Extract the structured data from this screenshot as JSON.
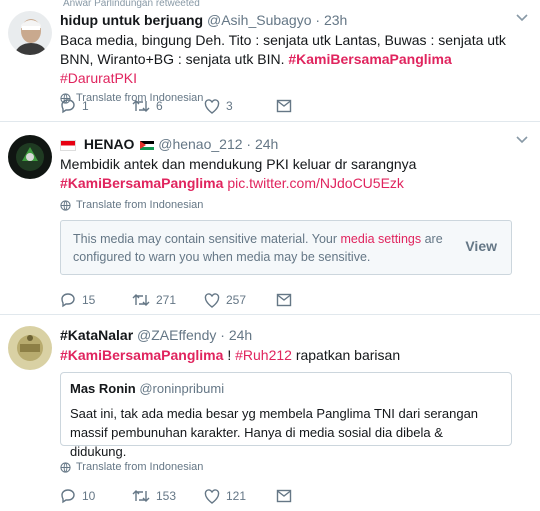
{
  "tweet1": {
    "top_context": "Anwar Parlindungan retweeted",
    "display_name": "hidup untuk berjuang",
    "handle": "@Asih_Subagyo",
    "time": "· 23h",
    "text": "Baca media, bingung Deh. Tito : senjata utk Lantas, Buwas : senjata utk BNN, Wiranto+BG : senjata utk BIN.",
    "hashtag1": "#KamiBersamaPanglima",
    "hashtag2": "#DaruratPKI",
    "translate": "Translate from Indonesian",
    "replies": "1",
    "retweets": "6",
    "likes": "3",
    "icons": [
      "reply-icon",
      "retweet-icon",
      "like-icon",
      "dm-icon",
      "globe-icon",
      "chevron-down-icon"
    ]
  },
  "tweet2": {
    "display_name": "HENAO",
    "handle": "@henao_212",
    "time": "· 24h",
    "text": "Membidik antek dan mendukung PKI keluar dr sarangnya",
    "hashtag": "#KamiBersamaPanglima",
    "link": "pic.twitter.com/NJdoCU5Ezk",
    "translate": "Translate from Indonesian",
    "sensitive_before": "This media may contain sensitive material. Your",
    "sensitive_link": "media settings",
    "sensitive_after": "are configured to warn you when media may be sensitive.",
    "view_label": "View",
    "replies": "15",
    "retweets": "271",
    "likes": "257"
  },
  "tweet3": {
    "display_name": "#KataNalar",
    "handle": "@ZAEffendy",
    "time": "· 24h",
    "hashtag": "#KamiBersamaPanglima",
    "sep": "!",
    "hashtag2": "#Ruh212",
    "text_after": "rapatkan barisan",
    "quote": {
      "display_name": "Mas Ronin",
      "handle": "@roninpribumi",
      "text": "Saat ini, tak ada media besar yg membela Panglima TNI dari serangan massif pembunuhan karakter. Hanya di media sosial dia dibela & didukung."
    },
    "translate": "Translate from Indonesian",
    "replies": "10",
    "retweets": "153",
    "likes": "121"
  },
  "colors": {
    "accent": "#e0245e",
    "muted": "#657786",
    "border": "#e1e8ed"
  }
}
